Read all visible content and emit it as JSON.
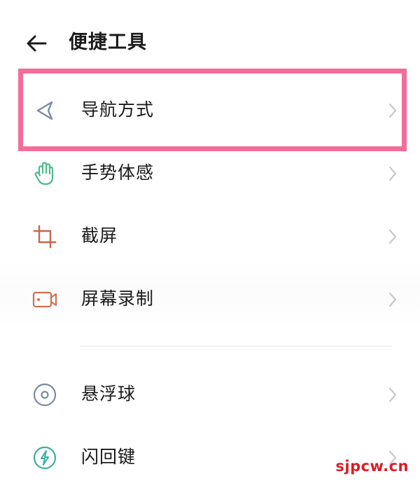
{
  "header": {
    "back_icon": "arrow-left-icon",
    "title": "便捷工具"
  },
  "items": [
    {
      "label": "导航方式",
      "icon": "navigation-arrow-icon",
      "icon_color": "#7d8ca3"
    },
    {
      "label": "手势体感",
      "icon": "hand-gesture-icon",
      "icon_color": "#4fb98a"
    },
    {
      "label": "截屏",
      "icon": "crop-screenshot-icon",
      "icon_color": "#c4684a"
    },
    {
      "label": "屏幕录制",
      "icon": "video-camera-icon",
      "icon_color": "#d37050"
    },
    {
      "label": "悬浮球",
      "icon": "floating-ball-icon",
      "icon_color": "#7c8ba2"
    },
    {
      "label": "闪回键",
      "icon": "flash-back-icon",
      "icon_color": "#3ab0a0"
    }
  ],
  "highlight_color": "#f26d9a",
  "chevron_color": "#c8c8c8",
  "watermark": "sjpcw.cn",
  "watermark_color": "#d81e27"
}
